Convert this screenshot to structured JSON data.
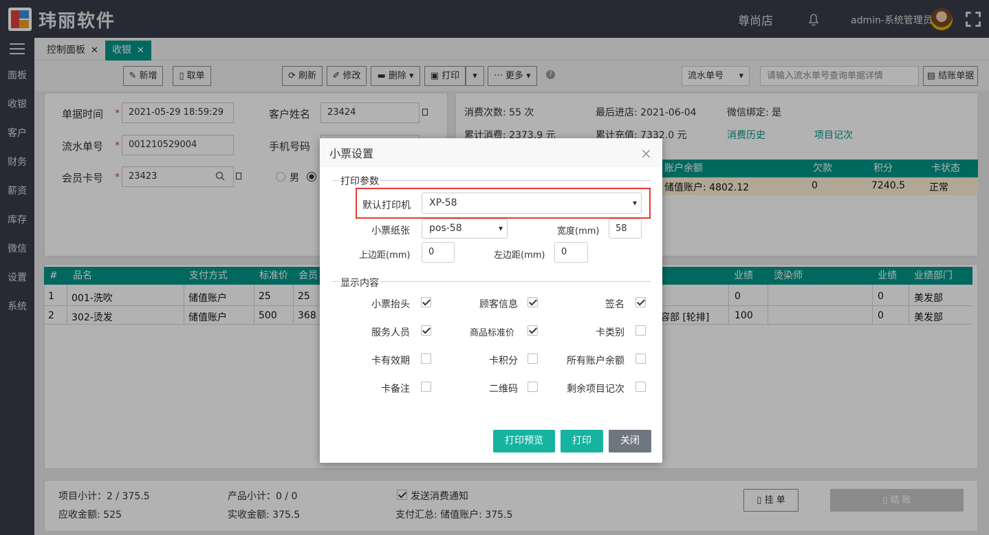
{
  "header": {
    "brand": "玮丽软件",
    "store": "尊尚店",
    "user": "admin-系统管理员"
  },
  "sidebar": {
    "items": [
      "面板",
      "收银",
      "客户",
      "财务",
      "薪资",
      "库存",
      "微信",
      "设置",
      "系统"
    ]
  },
  "tabs": [
    {
      "label": "控制面板"
    },
    {
      "label": "收银"
    }
  ],
  "toolbar": {
    "new": "新增",
    "take": "取单",
    "refresh": "刷新",
    "edit": "修改",
    "delete": "删除",
    "print": "打印",
    "more": "更多",
    "search_type": "流水单号",
    "search_placeholder": "请输入流水单号查询单据详情",
    "settled": "结账单据"
  },
  "form": {
    "time_label": "单据时间",
    "time_value": "2021-05-29 18:59:29",
    "serial_label": "流水单号",
    "serial_value": "001210529004",
    "card_label": "会员卡号",
    "card_value": "23423",
    "name_label": "客户姓名",
    "name_value": "23424",
    "phone_label": "手机号码",
    "gender_male": "男"
  },
  "customer": {
    "visits": "消费次数: 55 次",
    "last_visit": "最后进店: 2021-06-04",
    "wechat": "微信绑定: 是",
    "total_spent": "累计消费: 2373.9 元",
    "total_recharge": "累计充值: 7332.0 元",
    "history_link": "消费历史",
    "count_link": "项目记次",
    "account_headers": [
      "账户余额",
      "欠款",
      "积分",
      "卡状态"
    ],
    "account_row": [
      "储值账户: 4802.12",
      "0",
      "7240.5",
      "正常"
    ]
  },
  "items_table": {
    "headers": [
      "#",
      "品名",
      "支付方式",
      "标准价",
      "会员",
      "业绩",
      "烫染师",
      "业绩",
      "业绩部门"
    ],
    "rows": [
      {
        "no": "1",
        "name": "001-洗吹",
        "pay": "储值账户",
        "std": "25",
        "member": "25",
        "staff": "",
        "perf": "0",
        "perf2": "0",
        "dept": "美发部"
      },
      {
        "no": "2",
        "name": "302-烫发",
        "pay": "储值账户",
        "std": "500",
        "member": "368",
        "staff": "容部 [轮排]",
        "perf": "100",
        "perf2": "0",
        "dept": "美发部"
      }
    ]
  },
  "footer": {
    "item_subtotal": "项目小计：2 / 375.5",
    "product_subtotal": "产品小计：0 / 0",
    "notify": "发送消费通知",
    "receivable": "应收金额: 525",
    "received": "实收金额: 375.5",
    "payment_summary": "支付汇总: 储值账户: 375.5",
    "hold": "挂 单",
    "checkout": "结 账"
  },
  "modal": {
    "title": "小票设置",
    "section_params": "打印参数",
    "printer_label": "默认打印机",
    "printer_value": "XP-58",
    "paper_label": "小票纸张",
    "paper_value": "pos-58",
    "width_label": "宽度(mm)",
    "width_value": "58",
    "top_margin_label": "上边距(mm)",
    "top_margin_value": "0",
    "left_margin_label": "左边距(mm)",
    "left_margin_value": "0",
    "section_display": "显示内容",
    "options": [
      {
        "label": "小票抬头",
        "checked": true
      },
      {
        "label": "顾客信息",
        "checked": true
      },
      {
        "label": "签名",
        "checked": true
      },
      {
        "label": "服务人员",
        "checked": true
      },
      {
        "label": "商品标准价",
        "checked": true
      },
      {
        "label": "卡类别",
        "checked": false
      },
      {
        "label": "卡有效期",
        "checked": false
      },
      {
        "label": "卡积分",
        "checked": false
      },
      {
        "label": "所有账户余额",
        "checked": false
      },
      {
        "label": "卡备注",
        "checked": false
      },
      {
        "label": "二维码",
        "checked": false
      },
      {
        "label": "剩余项目记次",
        "checked": false
      }
    ],
    "preview_button": "打印预览",
    "print_button": "打印",
    "close_button": "关闭",
    "colors": {
      "primary": "#16b3a0",
      "secondary": "#6e7780",
      "highlight": "#e53935"
    }
  }
}
